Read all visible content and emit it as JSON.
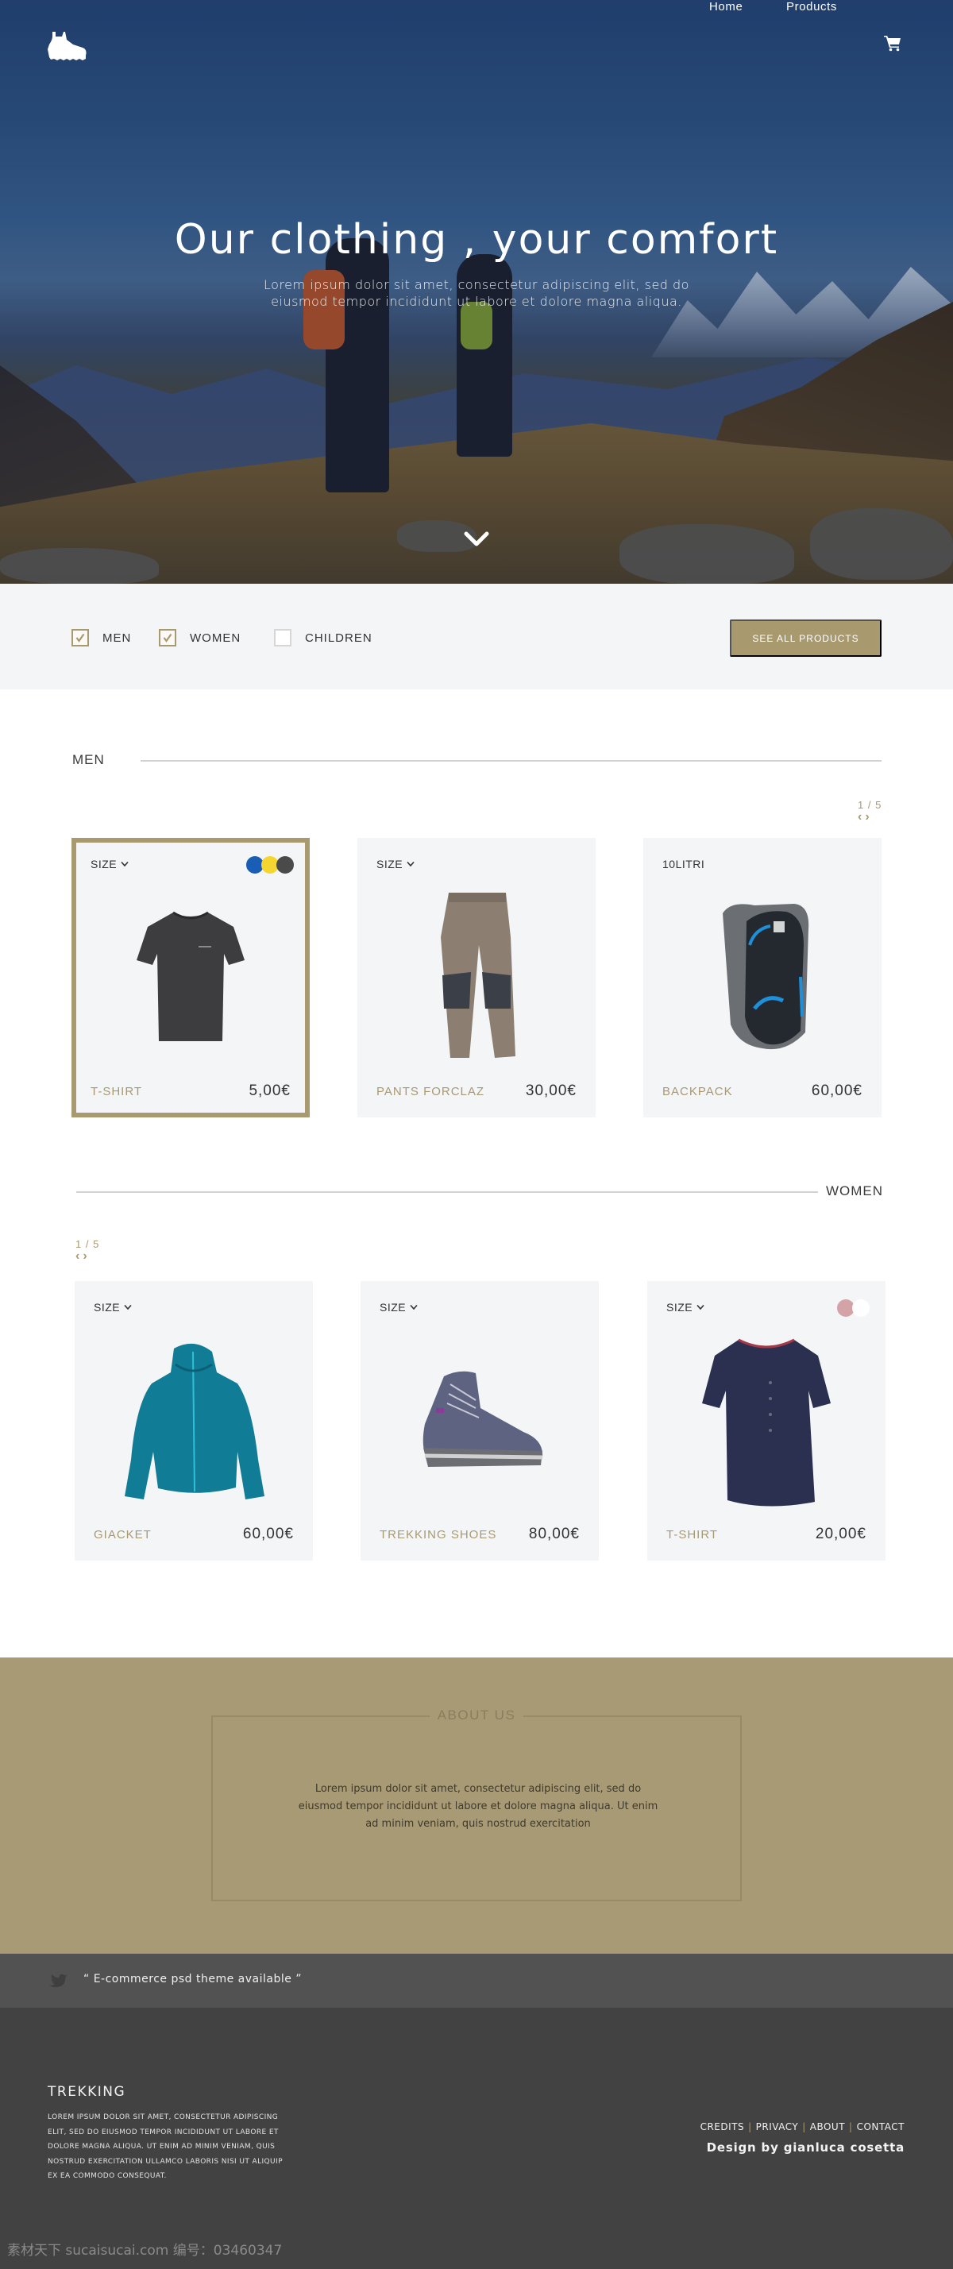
{
  "header": {
    "logo_icon": "hiking-boot-icon",
    "nav": [
      {
        "label": "Home"
      },
      {
        "label": "Products"
      }
    ],
    "cart_icon": "shopping-cart-icon"
  },
  "hero": {
    "title": "Our clothing , your comfort",
    "subtitle": "Lorem ipsum dolor sit amet, consectetur adipiscing elit, sed do eiusmod tempor incididunt ut labore et dolore magna aliqua.",
    "scroll_icon": "chevron-down-icon"
  },
  "filters": {
    "options": [
      {
        "label": "MEN",
        "checked": true
      },
      {
        "label": "WOMEN",
        "checked": true
      },
      {
        "label": "CHILDREN",
        "checked": false
      }
    ],
    "see_all_label": "SEE ALL PRODUCTS"
  },
  "sections": [
    {
      "title": "MEN",
      "pager": {
        "current": 1,
        "total": 5,
        "label": "1 / 5",
        "prev": "‹",
        "next": "›"
      },
      "products": [
        {
          "selector": "SIZE",
          "selector_dropdown": true,
          "name": "T-SHIRT",
          "price": "5,00€",
          "image": "black-tshirt",
          "selected": true,
          "colors": [
            "#1a5db5",
            "#f5d630",
            "#4a4a4a"
          ]
        },
        {
          "selector": "SIZE",
          "selector_dropdown": true,
          "name": "PANTS FORCLAZ",
          "price": "30,00€",
          "image": "khaki-pants",
          "selected": false,
          "colors": []
        },
        {
          "selector": "10LITRI",
          "selector_dropdown": false,
          "name": "BACKPACK",
          "price": "60,00€",
          "image": "black-backpack",
          "selected": false,
          "colors": []
        }
      ]
    },
    {
      "title": "WOMEN",
      "pager": {
        "current": 1,
        "total": 5,
        "label": "1 / 5",
        "prev": "‹",
        "next": "›"
      },
      "products": [
        {
          "selector": "SIZE",
          "selector_dropdown": true,
          "name": "GIACKET",
          "price": "60,00€",
          "image": "teal-jacket",
          "selected": false,
          "colors": []
        },
        {
          "selector": "SIZE",
          "selector_dropdown": true,
          "name": "TREKKING SHOES",
          "price": "80,00€",
          "image": "grey-boot",
          "selected": false,
          "colors": []
        },
        {
          "selector": "SIZE",
          "selector_dropdown": true,
          "name": "T-SHIRT",
          "price": "20,00€",
          "image": "navy-tshirt",
          "selected": false,
          "colors": [
            "#d4a3a8",
            "#ffffff"
          ]
        }
      ]
    }
  ],
  "about": {
    "title": "ABOUT US",
    "text": "Lorem ipsum dolor sit amet, consectetur adipiscing elit, sed do eiusmod tempor incididunt ut labore et dolore magna aliqua. Ut enim ad minim veniam, quis nostrud exercitation"
  },
  "tweet": {
    "icon": "twitter-bird-icon",
    "text": "“ E-commerce psd theme available ”"
  },
  "footer": {
    "brand": "TREKKING",
    "brand_text": "LOREM IPSUM DOLOR SIT AMET, CONSECTETUR ADIPISCING ELIT, SED DO EIUSMOD TEMPOR INCIDIDUNT UT LABORE ET DOLORE MAGNA ALIQUA. UT ENIM AD MINIM VENIAM, QUIS NOSTRUD EXERCITATION ULLAMCO LABORIS NISI UT ALIQUIP EX EA COMMODO CONSEQUAT.",
    "links": [
      {
        "label": "CREDITS"
      },
      {
        "label": "PRIVACY"
      },
      {
        "label": "ABOUT"
      },
      {
        "label": "CONTACT"
      }
    ],
    "separator": "|",
    "credit": "Design by gianluca cosetta",
    "watermark": "素材天下 sucaisucai.com  编号：03460347"
  },
  "colors": {
    "accent": "#a9996f",
    "filter_bg": "#f4f5f7",
    "card_bg": "#f4f5f7",
    "about_bg": "#a89a74",
    "tweet_bg": "#525252",
    "footer_bg": "#424242"
  }
}
